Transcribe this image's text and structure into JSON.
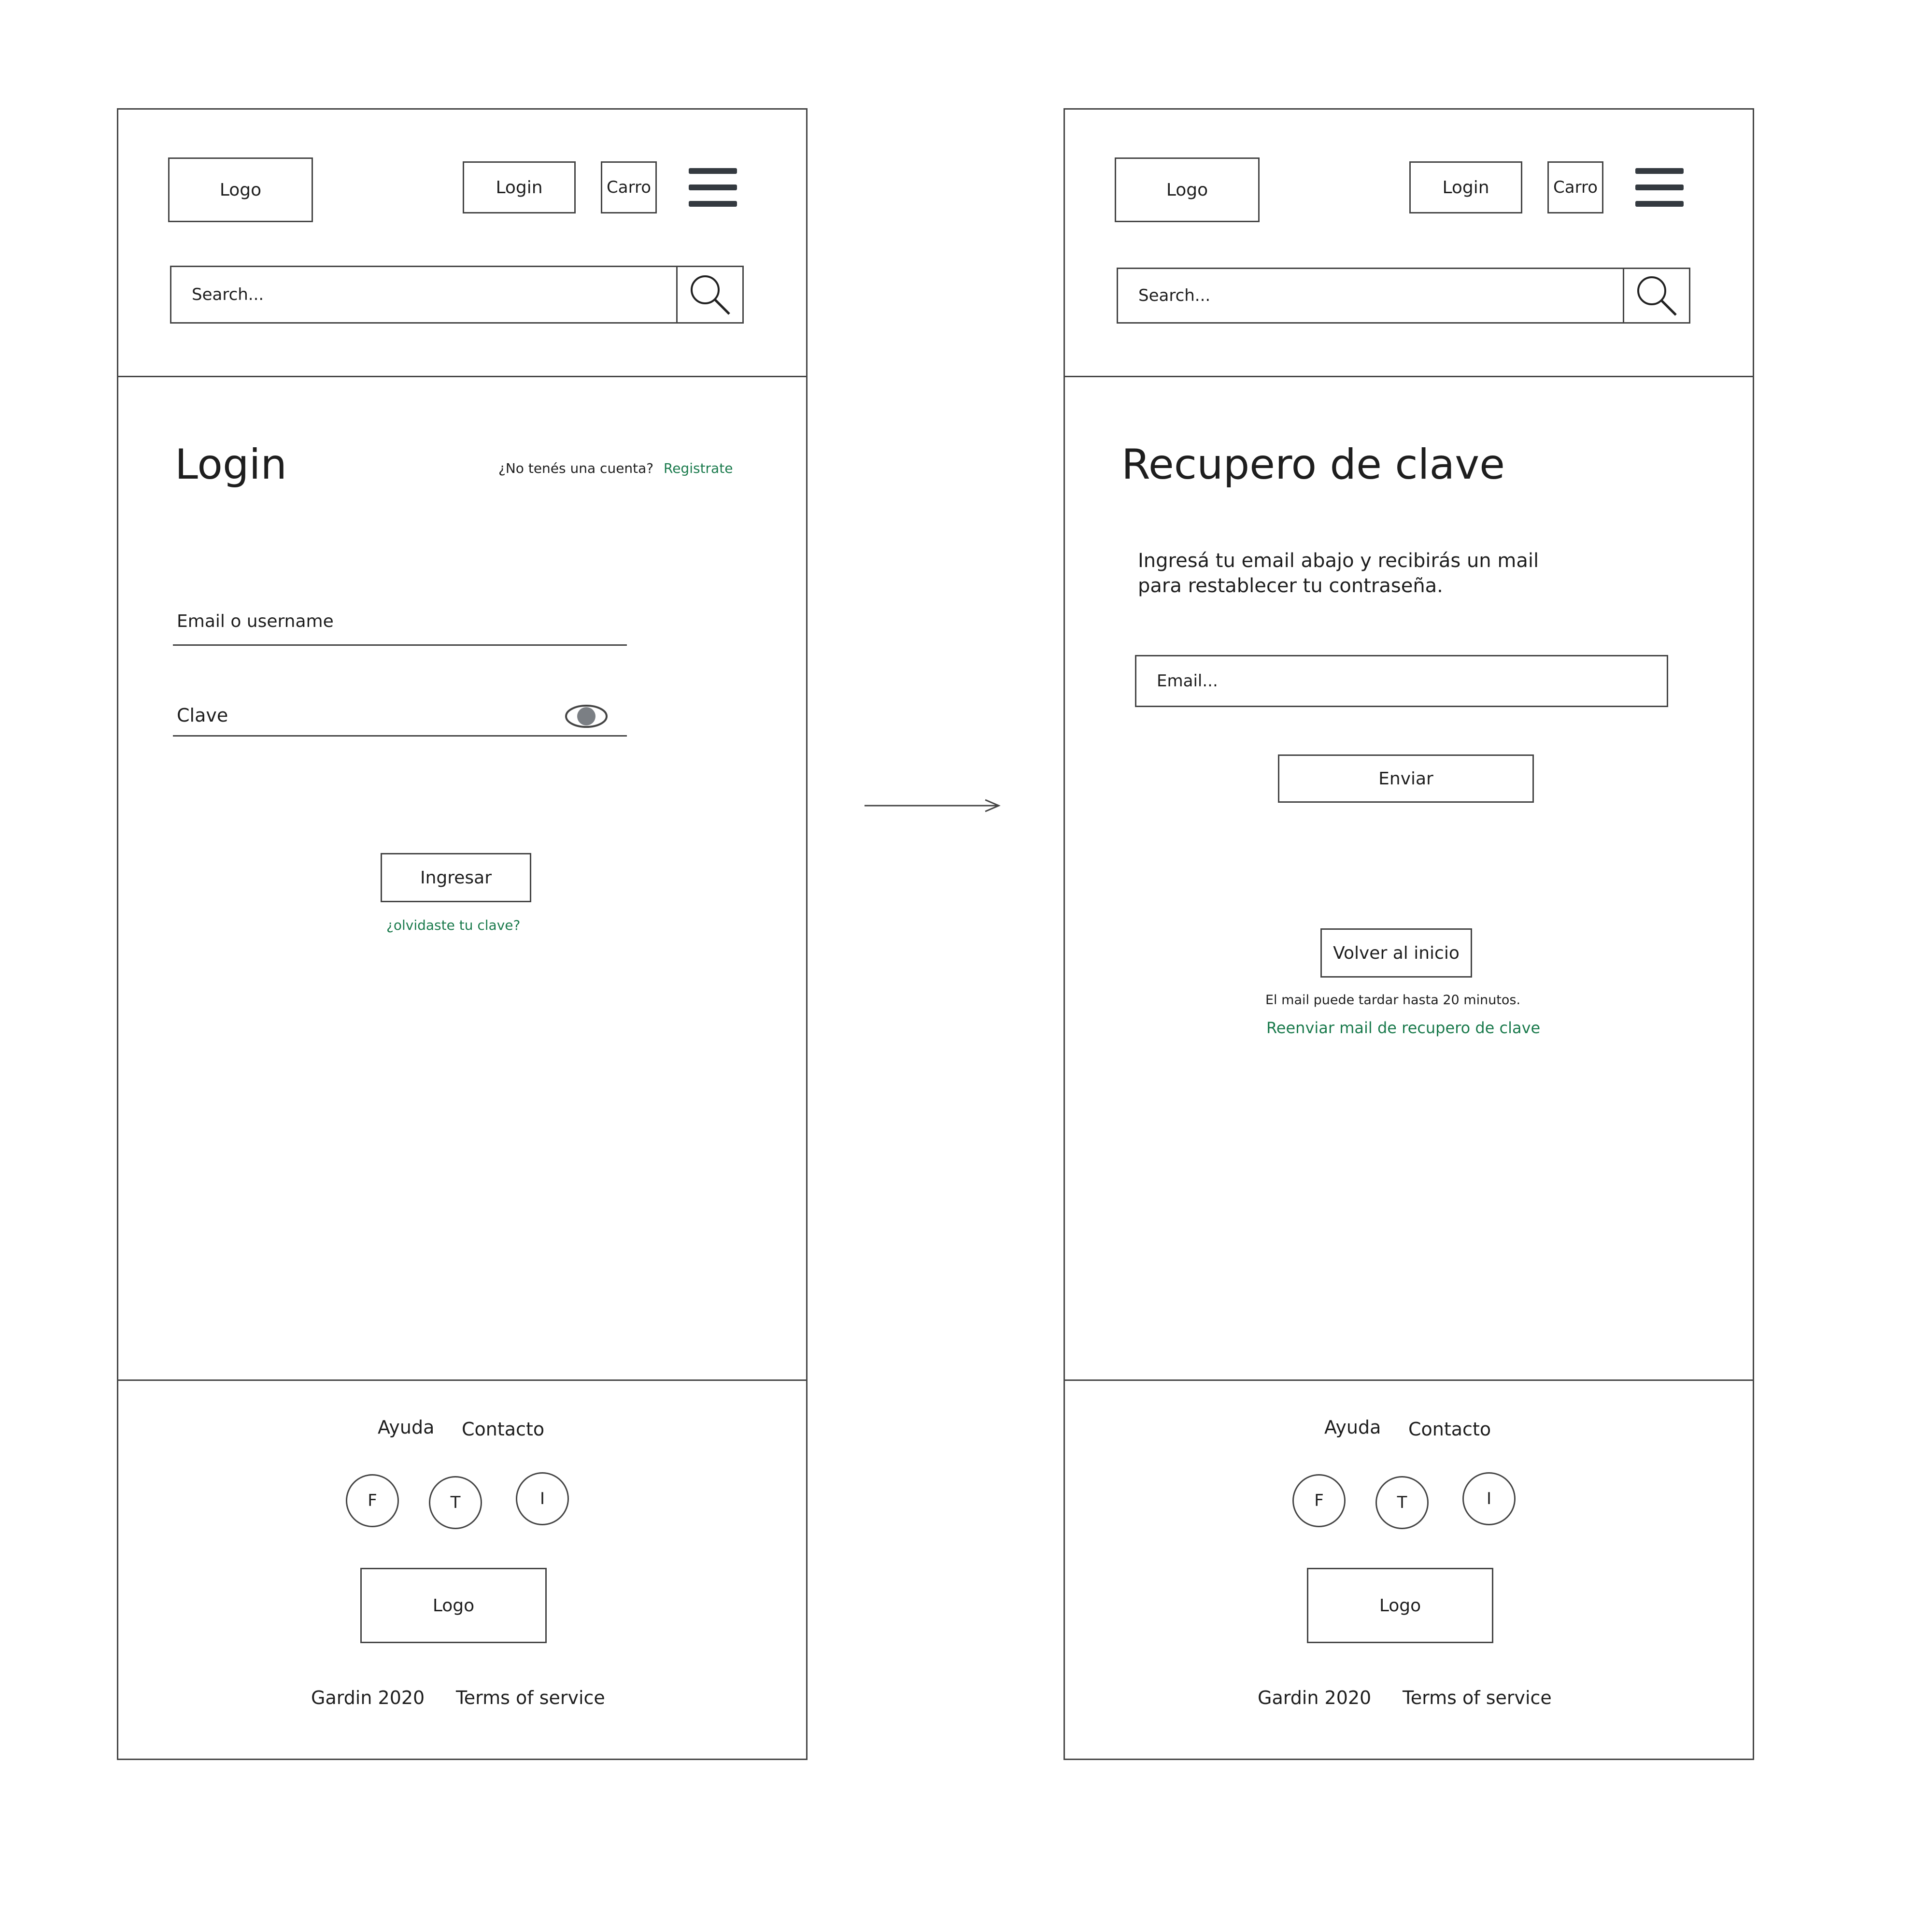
{
  "header": {
    "logo": "Logo",
    "login": "Login",
    "cart": "Carro",
    "search_placeholder": "Search..."
  },
  "login_screen": {
    "title": "Login",
    "no_account_prompt": "¿No tenés una cuenta?",
    "register_link": "Registrate",
    "email_label": "Email o username",
    "password_label": "Clave",
    "submit": "Ingresar",
    "forgot_link": "¿olvidaste tu clave?"
  },
  "recovery_screen": {
    "title": "Recupero de clave",
    "instruction_line1": "Ingresá tu email abajo y recibirás un mail",
    "instruction_line2": "para restablecer tu contraseña.",
    "email_placeholder": "Email...",
    "send": "Enviar",
    "back_home": "Volver al inicio",
    "delay_note": "El mail puede tardar hasta 20 minutos.",
    "resend_link": "Reenviar mail de recupero de clave"
  },
  "footer": {
    "help": "Ayuda",
    "contact": "Contacto",
    "social": [
      "F",
      "T",
      "I"
    ],
    "logo": "Logo",
    "copyright": "Gardin 2020",
    "terms": "Terms of service"
  },
  "colors": {
    "link": "#1a7a4c",
    "stroke": "#444444",
    "menu_icon": "#343a40"
  }
}
